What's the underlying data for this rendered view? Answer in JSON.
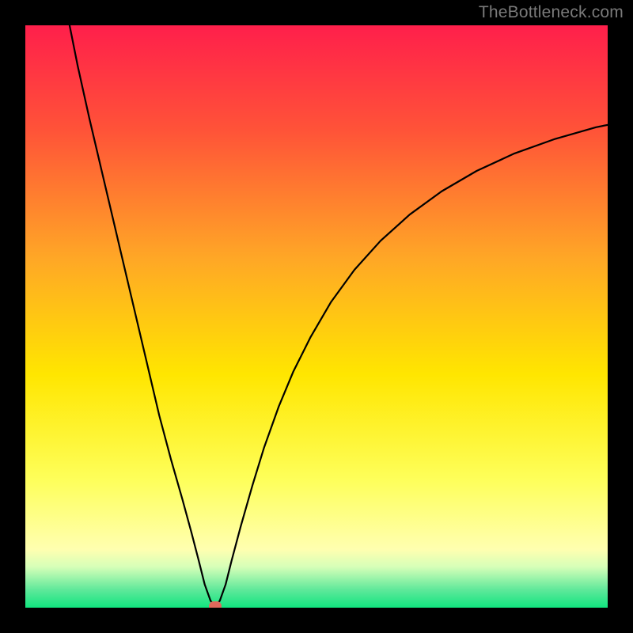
{
  "watermark": "TheBottleneck.com",
  "chart_data": {
    "type": "line",
    "title": "",
    "xlabel": "",
    "ylabel": "",
    "xlim": [
      0,
      100
    ],
    "ylim": [
      0,
      100
    ],
    "gradient_stops": [
      {
        "offset": 0,
        "color": "#ff1f4b"
      },
      {
        "offset": 18,
        "color": "#ff5338"
      },
      {
        "offset": 40,
        "color": "#ffa726"
      },
      {
        "offset": 60,
        "color": "#ffe600"
      },
      {
        "offset": 78,
        "color": "#feff5a"
      },
      {
        "offset": 90,
        "color": "#ffffb0"
      },
      {
        "offset": 93,
        "color": "#d6ffb8"
      },
      {
        "offset": 97,
        "color": "#5de89a"
      },
      {
        "offset": 100,
        "color": "#11e57f"
      }
    ],
    "series": [
      {
        "name": "bottleneck-curve",
        "points": [
          {
            "x": 7.5,
            "y": 100.5
          },
          {
            "x": 9.0,
            "y": 93.0
          },
          {
            "x": 11.0,
            "y": 84.0
          },
          {
            "x": 13.0,
            "y": 75.5
          },
          {
            "x": 15.0,
            "y": 67.0
          },
          {
            "x": 17.0,
            "y": 58.5
          },
          {
            "x": 19.0,
            "y": 50.0
          },
          {
            "x": 21.0,
            "y": 41.5
          },
          {
            "x": 23.0,
            "y": 33.0
          },
          {
            "x": 25.0,
            "y": 25.5
          },
          {
            "x": 27.0,
            "y": 18.5
          },
          {
            "x": 28.5,
            "y": 13.0
          },
          {
            "x": 29.8,
            "y": 8.0
          },
          {
            "x": 30.8,
            "y": 4.0
          },
          {
            "x": 31.8,
            "y": 1.2
          },
          {
            "x": 32.6,
            "y": 0.2
          },
          {
            "x": 33.4,
            "y": 1.2
          },
          {
            "x": 34.4,
            "y": 4.0
          },
          {
            "x": 35.4,
            "y": 8.0
          },
          {
            "x": 37.0,
            "y": 14.0
          },
          {
            "x": 39.0,
            "y": 21.0
          },
          {
            "x": 41.0,
            "y": 27.5
          },
          {
            "x": 43.5,
            "y": 34.5
          },
          {
            "x": 46.0,
            "y": 40.5
          },
          {
            "x": 49.0,
            "y": 46.5
          },
          {
            "x": 52.5,
            "y": 52.5
          },
          {
            "x": 56.5,
            "y": 58.0
          },
          {
            "x": 61.0,
            "y": 63.0
          },
          {
            "x": 66.0,
            "y": 67.5
          },
          {
            "x": 71.5,
            "y": 71.5
          },
          {
            "x": 77.5,
            "y": 75.0
          },
          {
            "x": 84.0,
            "y": 78.0
          },
          {
            "x": 91.0,
            "y": 80.5
          },
          {
            "x": 98.0,
            "y": 82.5
          },
          {
            "x": 100.5,
            "y": 83.0
          }
        ]
      }
    ],
    "marker": {
      "x": 32.6,
      "y": 0.3,
      "color": "#e0685c"
    }
  }
}
